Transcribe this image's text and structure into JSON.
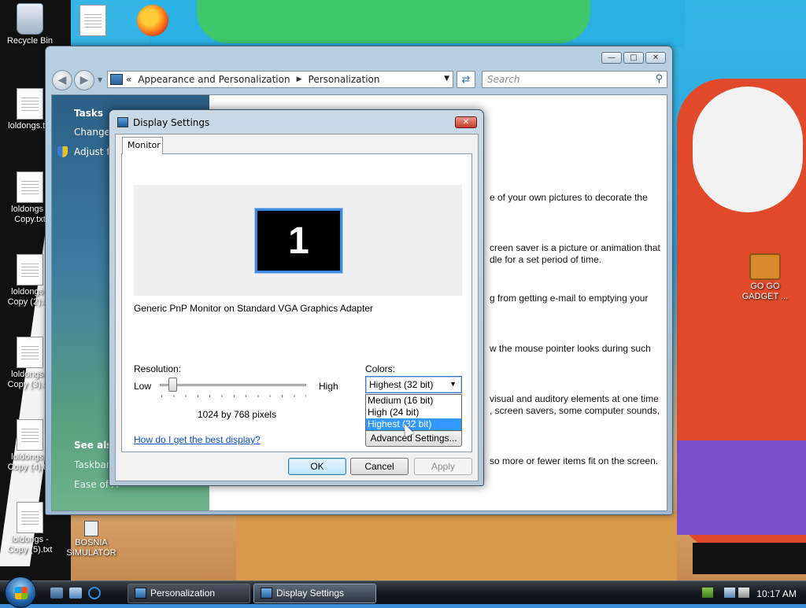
{
  "desktop": {
    "icons": [
      {
        "label": "Recycle Bin",
        "icon": "recycle-bin-icon"
      },
      {
        "label": "loldongs.txt",
        "icon": "text-file-icon"
      },
      {
        "label": "loldongs - Copy.txt",
        "icon": "text-file-icon"
      },
      {
        "label": "loldongs - Copy (2).txt",
        "icon": "text-file-icon"
      },
      {
        "label": "loldongs - Copy (3).txt",
        "icon": "text-file-icon"
      },
      {
        "label": "loldongs - Copy (4).txt",
        "icon": "text-file-icon"
      },
      {
        "label": "loldongs - Copy (5).txt",
        "icon": "text-file-icon"
      },
      {
        "label": "BOSNIA SIMULATOR",
        "icon": "shortcut-icon"
      },
      {
        "label": "GO GO GADGET ...",
        "icon": "briefcase-icon"
      }
    ]
  },
  "personalization": {
    "breadcrumb": {
      "prefix": "«",
      "items": [
        "Appearance and Personalization",
        "Personalization"
      ]
    },
    "search_placeholder": "Search",
    "tasks": {
      "heading": "Tasks",
      "items": [
        "Change d",
        "Adjust fo"
      ]
    },
    "see_also": {
      "heading": "See also",
      "items": [
        "Taskbar a",
        "Ease of A"
      ]
    },
    "content_lines": [
      "e of your own pictures to decorate the",
      "creen saver is a picture or animation that",
      "dle for a set period of time.",
      "g from getting e-mail to emptying your",
      "w the mouse pointer looks during such",
      "visual and auditory elements at one time",
      ", screen savers, some computer sounds,",
      " so more or fewer items fit on the screen."
    ]
  },
  "dialog": {
    "title": "Display Settings",
    "tab": "Monitor",
    "monitor_number": "1",
    "monitor_desc": "Generic PnP Monitor on Standard VGA Graphics Adapter",
    "resolution": {
      "label": "Resolution:",
      "low": "Low",
      "high": "High",
      "value_text": "1024 by 768 pixels",
      "slider_position": 0.09
    },
    "colors": {
      "label": "Colors:",
      "selected": "Highest (32 bit)",
      "options": [
        "Medium (16 bit)",
        "High (24 bit)",
        "Highest (32 bit)"
      ]
    },
    "advanced_button": "Advanced Settings...",
    "help_link": "How do I get the best display?",
    "buttons": {
      "ok": "OK",
      "cancel": "Cancel",
      "apply": "Apply"
    }
  },
  "taskbar": {
    "buttons": [
      "Personalization",
      "Display Settings"
    ],
    "clock": "10:17 AM"
  }
}
